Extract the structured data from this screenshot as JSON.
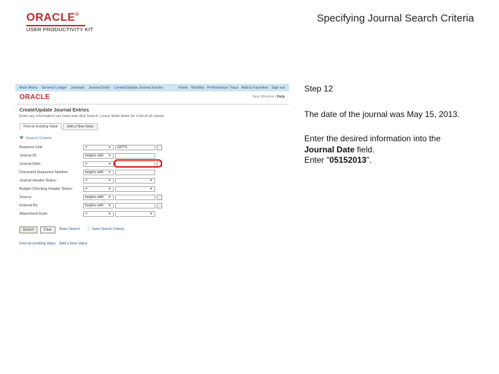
{
  "brand": {
    "logo": "ORACLE",
    "subline": "USER PRODUCTIVITY KIT"
  },
  "slide_title": "Specifying Journal Search Criteria",
  "instructions": {
    "step_label": "Step 12",
    "line1": "The date of the journal was May 15, 2013.",
    "line2a": "Enter the desired information into the ",
    "line2b": "Journal Date",
    "line2c": " field.",
    "line3a": "Enter \"",
    "line3b": "05152013",
    "line3c": "\"."
  },
  "app": {
    "breadcrumbs": [
      "Main Menu",
      "General Ledger",
      "Journals",
      "Journal Entry",
      "Create/Update Journal Entries"
    ],
    "toplinks": [
      "Home",
      "Worklist",
      "Performance Trace",
      "Add to Favorites",
      "Sign out"
    ],
    "mini_logo": "ORACLE",
    "personalize": {
      "label": "New Window",
      "sep": "|",
      "help": "Help"
    },
    "page_title": "Create/Update Journal Entries",
    "page_hint": "Enter any information you have and click Search. Leave fields blank for a list of all values.",
    "tabs": {
      "find": "Find an Existing Value",
      "add": "Add a New Value"
    },
    "search_criteria_label": "Search Criteria",
    "fields": {
      "bu": {
        "label": "Business Unit:",
        "op": "=",
        "val": "GRTS"
      },
      "jid": {
        "label": "Journal ID:",
        "op": "begins with",
        "val": ""
      },
      "jdate": {
        "label": "Journal Date:",
        "op": "=",
        "val": ""
      },
      "unpost": {
        "label": "Document Sequence Number:",
        "op": "begins with",
        "val": ""
      },
      "jhstat": {
        "label": "Journal Header Status:",
        "op": "=",
        "val": ""
      },
      "bhstat": {
        "label": "Budget Checking Header Status:",
        "op": "=",
        "val": ""
      },
      "src": {
        "label": "Source:",
        "op": "begins with",
        "val": ""
      },
      "euser": {
        "label": "Entered By:",
        "op": "begins with",
        "val": ""
      },
      "attach": {
        "label": "Attachment Exist:",
        "op": "=",
        "val": ""
      }
    },
    "buttons": {
      "search": "Search",
      "clear": "Clear",
      "basic": "Basic Search",
      "save": "Save Search Criteria"
    },
    "footer": [
      "Find an Existing Value",
      "Add a New Value"
    ]
  }
}
